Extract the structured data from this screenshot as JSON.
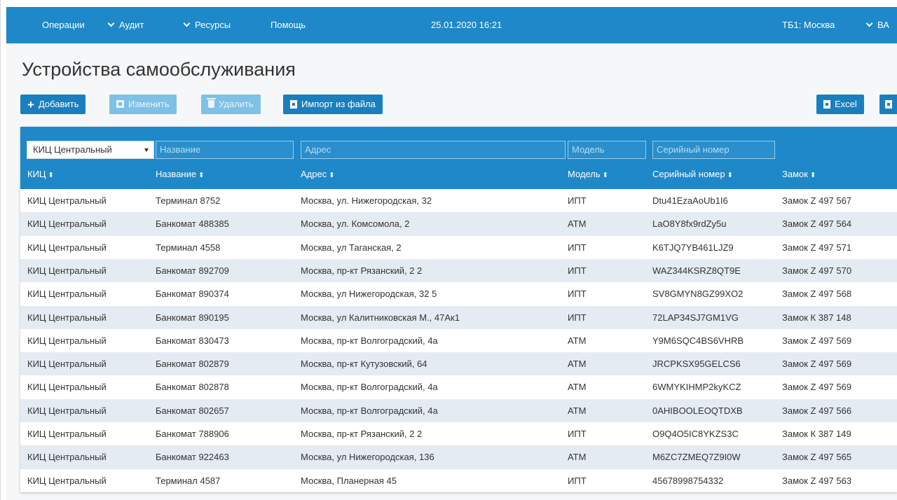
{
  "nav": {
    "items": [
      {
        "label": "Операции",
        "dropdown": false
      },
      {
        "label": "Аудит",
        "dropdown": true
      },
      {
        "label": "Ресурсы",
        "dropdown": true
      },
      {
        "label": "Помощь",
        "dropdown": false
      }
    ],
    "datetime": "25.01.2020 16:21",
    "branch": "ТБ1: Москва",
    "user": "ВА"
  },
  "page": {
    "title": "Устройства самообслуживания"
  },
  "toolbar": {
    "add_label": "Добавить",
    "edit_label": "Изменить",
    "delete_label": "Удалить",
    "import_label": "Импорт из файла",
    "excel_label": "Excel"
  },
  "colors": {
    "accent": "#1e88c8",
    "button": "#1a7fbe",
    "button_disabled": "#7ec0e6",
    "row_stripe": "#e4ebf2"
  },
  "filters": {
    "kic_selected": "КИЦ Центральный",
    "name_placeholder": "Название",
    "address_placeholder": "Адрес",
    "model_placeholder": "Модель",
    "serial_placeholder": "Серийный номер"
  },
  "table": {
    "columns": [
      "КИЦ",
      "Название",
      "Адрес",
      "Модель",
      "Серийный номер",
      "Замок"
    ],
    "sort_glyph": "⬍",
    "rows": [
      [
        "КИЦ Центральный",
        "Терминал 8752",
        "Москва, ул. Нижегородская, 32",
        "ИПТ",
        "Dtu41EzaAoUb1I6",
        "Замок Z 497 567"
      ],
      [
        "КИЦ Центральный",
        "Банкомат 488385",
        "Москва, ул. Комсомола, 2",
        "АТМ",
        "LaO8Y8fx9rdZy5u",
        "Замок Z 497 564"
      ],
      [
        "КИЦ Центральный",
        "Терминал 4558",
        "Москва, ул Таганская, 2",
        "ИПТ",
        "K6TJQ7YB461LJZ9",
        "Замок Z 497 571"
      ],
      [
        "КИЦ Центральный",
        "Банкомат 892709",
        "Москва, пр-кт Рязанский, 2 2",
        "ИПТ",
        "WAZ344KSRZ8QT9E",
        "Замок Z 497 570"
      ],
      [
        "КИЦ Центральный",
        "Банкомат 890374",
        "Москва, ул Нижегородская, 32 5",
        "ИПТ",
        "SV8GMYN8GZ99XO2",
        "Замок Z 497 568"
      ],
      [
        "КИЦ Центральный",
        "Банкомат 890195",
        "Москва, ул Калитниковская М., 47Ак1",
        "ИПТ",
        "72LAP34SJ7GM1VG",
        "Замок К 387 148"
      ],
      [
        "КИЦ Центральный",
        "Банкомат 830473",
        "Москва, пр-кт Волгоградский, 4а",
        "АТМ",
        "Y9M6SQC4BS6VHRB",
        "Замок Z 497 569"
      ],
      [
        "КИЦ Центральный",
        "Банкомат 802879",
        "Москва, пр-кт Кутузовский, 64",
        "АТМ",
        "JRCPKSX95GELCS6",
        "Замок Z 497 569"
      ],
      [
        "КИЦ Центральный",
        "Банкомат 802878",
        "Москва, пр-кт Волгоградский, 4а",
        "АТМ",
        "6WMYKIHMP2kyKCZ",
        "Замок Z 497 569"
      ],
      [
        "КИЦ Центральный",
        "Банкомат 802657",
        "Москва, пр-кт Волгоградский, 4а",
        "АТМ",
        "0AHIBOOLEOQTDXB",
        "Замок Z 497 566"
      ],
      [
        "КИЦ Центральный",
        "Банкомат 788906",
        "Москва, пр-кт Рязанский, 2 2",
        "ИПТ",
        "O9Q4O5IC8YKZS3C",
        "Замок К 387 149"
      ],
      [
        "КИЦ Центральный",
        "Банкомат 922463",
        "Москва, ул Нижегородская, 136",
        "АТМ",
        "M6ZC7ZMEQ7Z9I0W",
        "Замок Z 497 565"
      ],
      [
        "КИЦ Центральный",
        "Терминал 4587",
        "Москва, Планерная 45",
        "ИПТ",
        "45678998754332",
        "Замок Z 497 563"
      ]
    ]
  }
}
